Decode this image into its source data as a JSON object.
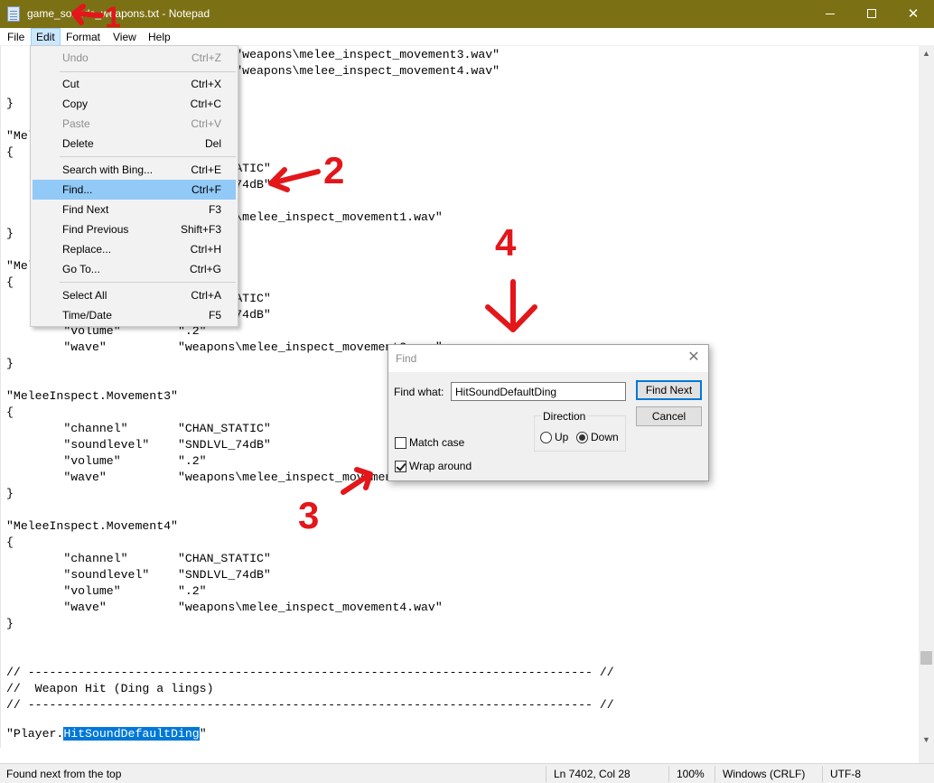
{
  "window": {
    "title": "game_sounds_weapons.txt - Notepad",
    "minimize_glyph": "—",
    "maximize_glyph": "☐",
    "close_glyph": "✕",
    "titlebar_color": "#7c7014"
  },
  "menubar": {
    "file": "File",
    "edit": "Edit",
    "format": "Format",
    "view": "View",
    "help": "Help"
  },
  "editor": {
    "lines": [
      "\t\t\t\t\"weapons\\melee_inspect_movement3.wav\"",
      "\t\t\t\t\"weapons\\melee_inspect_movement4.wav\"",
      "",
      "}",
      "",
      "\"MeleeInspect.Movement1\"",
      "{",
      "\t\"channel\"\t\"CHAN_STATIC\"",
      "\t\"soundlevel\"\t\"SNDLVL_74dB\"",
      "",
      "\t\"wave\"\t\t\"weapons\\melee_inspect_movement1.wav\"",
      "}",
      "",
      "\"MeleeInspect.Movement2\"",
      "{",
      "\t\"channel\"\t\"CHAN_STATIC\"",
      "\t\"soundlevel\"\t\"SNDLVL_74dB\"",
      "\t\"volume\"\t\".2\"",
      "\t\"wave\"\t\t\"weapons\\melee_inspect_movement2.wav\"",
      "}",
      "",
      "\"MeleeInspect.Movement3\"",
      "{",
      "\t\"channel\"\t\"CHAN_STATIC\"",
      "\t\"soundlevel\"\t\"SNDLVL_74dB\"",
      "\t\"volume\"\t\".2\"",
      "\t\"wave\"\t\t\"weapons\\melee_inspect_movement3.wav\"",
      "}",
      "",
      "\"MeleeInspect.Movement4\"",
      "{",
      "\t\"channel\"\t\"CHAN_STATIC\"",
      "\t\"soundlevel\"\t\"SNDLVL_74dB\"",
      "\t\"volume\"\t\".2\"",
      "\t\"wave\"\t\t\"weapons\\melee_inspect_movement4.wav\"",
      "}",
      "",
      "",
      "// ------------------------------------------------------------------------------- //",
      "//  Weapon Hit (Ding a lings)",
      "// ------------------------------------------------------------------------------- //",
      ""
    ],
    "last_line_prefix": "\"Player.",
    "last_line_selected": "HitSoundDefaultDing",
    "last_line_suffix": "\""
  },
  "edit_menu": {
    "items": [
      {
        "label": "Undo",
        "shortcut": "Ctrl+Z",
        "disabled": true
      },
      {
        "label": "Cut",
        "shortcut": "Ctrl+X",
        "disabled": false
      },
      {
        "label": "Copy",
        "shortcut": "Ctrl+C",
        "disabled": false
      },
      {
        "label": "Paste",
        "shortcut": "Ctrl+V",
        "disabled": true
      },
      {
        "label": "Delete",
        "shortcut": "Del",
        "disabled": false
      },
      {
        "label": "Search with Bing...",
        "shortcut": "Ctrl+E",
        "disabled": false
      },
      {
        "label": "Find...",
        "shortcut": "Ctrl+F",
        "disabled": false,
        "highlighted": true
      },
      {
        "label": "Find Next",
        "shortcut": "F3",
        "disabled": false
      },
      {
        "label": "Find Previous",
        "shortcut": "Shift+F3",
        "disabled": false
      },
      {
        "label": "Replace...",
        "shortcut": "Ctrl+H",
        "disabled": false
      },
      {
        "label": "Go To...",
        "shortcut": "Ctrl+G",
        "disabled": false
      },
      {
        "label": "Select All",
        "shortcut": "Ctrl+A",
        "disabled": false
      },
      {
        "label": "Time/Date",
        "shortcut": "F5",
        "disabled": false
      }
    ]
  },
  "find_dialog": {
    "title": "Find",
    "find_what_label": "Find what:",
    "find_what_value": "HitSoundDefaultDing",
    "find_next_button": "Find Next",
    "cancel_button": "Cancel",
    "direction_label": "Direction",
    "up_label": "Up",
    "down_label": "Down",
    "direction_selected": "Down",
    "match_case_label": "Match case",
    "match_case_checked": false,
    "wrap_around_label": "Wrap around",
    "wrap_around_checked": true
  },
  "statusbar": {
    "message": "Found next from the top",
    "position": "Ln 7402, Col 28",
    "zoom": "100%",
    "line_endings": "Windows (CRLF)",
    "encoding": "UTF-8"
  },
  "annotations": {
    "labels": [
      "1",
      "2",
      "3",
      "4"
    ],
    "color": "#e3161a"
  },
  "colors": {
    "selection": "#0078d7",
    "menu_highlight": "#91c9f7"
  }
}
